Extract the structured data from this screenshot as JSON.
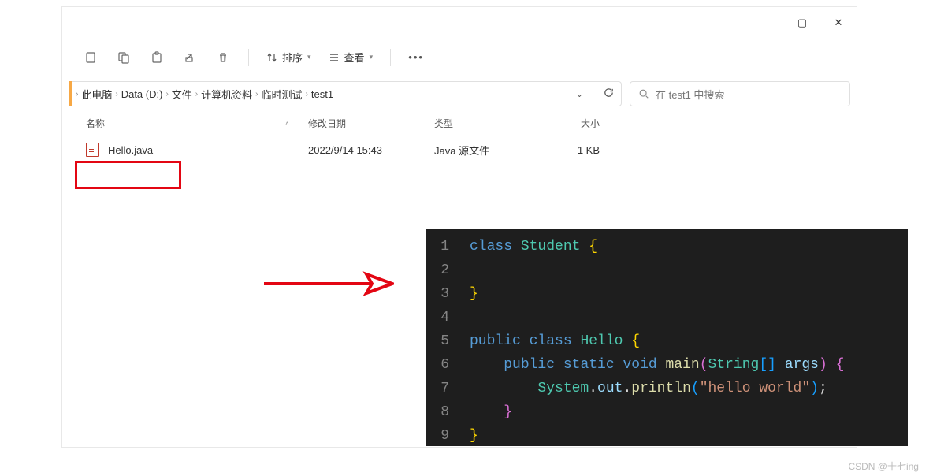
{
  "window_controls": {
    "min": "—",
    "max": "▢",
    "close": "✕"
  },
  "toolbar": {
    "sort_label": "排序",
    "view_label": "查看"
  },
  "breadcrumb": [
    "此电脑",
    "Data (D:)",
    "文件",
    "计算机资料",
    "临时测试",
    "test1"
  ],
  "search": {
    "placeholder": "在 test1 中搜索"
  },
  "columns": {
    "name": "名称",
    "date": "修改日期",
    "type": "类型",
    "size": "大小"
  },
  "file": {
    "name": "Hello.java",
    "date": "2022/9/14 15:43",
    "type": "Java 源文件",
    "size": "1 KB"
  },
  "code": {
    "class1": "class",
    "student": "Student",
    "public": "public",
    "class2": "class",
    "hello": "Hello",
    "static": "static",
    "void": "void",
    "main": "main",
    "string": "String",
    "args": "args",
    "system": "System",
    "out": "out",
    "println": "println",
    "str": "\"hello world\"",
    "line_nums": [
      "1",
      "2",
      "3",
      "4",
      "5",
      "6",
      "7",
      "8",
      "9"
    ]
  },
  "watermark": "CSDN @十七ing"
}
